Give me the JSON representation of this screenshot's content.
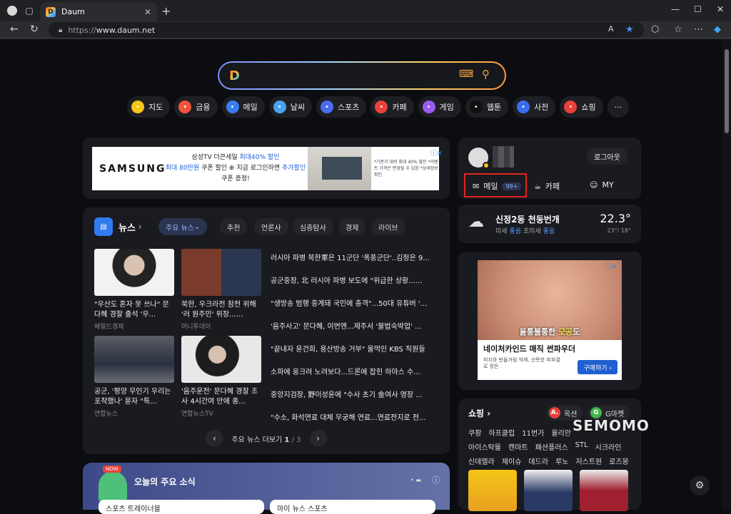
{
  "browser": {
    "tab_title": "Daum",
    "url_protocol": "https://",
    "url_host": "www.daum.net",
    "read_aloud_label": "A"
  },
  "search": {
    "placeholder": ""
  },
  "quick_links": [
    {
      "label": "지도",
      "icon": "map-pin-icon",
      "color": "#f5c518"
    },
    {
      "label": "금융",
      "icon": "chart-icon",
      "color": "#f2553c"
    },
    {
      "label": "메일",
      "icon": "mail-icon",
      "color": "#3a7df0"
    },
    {
      "label": "날씨",
      "icon": "cloud-icon",
      "color": "#4aa3f0"
    },
    {
      "label": "스포츠",
      "icon": "sports-icon",
      "color": "#4a6cf0"
    },
    {
      "label": "카페",
      "icon": "cafe-icon",
      "color": "#e8423a"
    },
    {
      "label": "게임",
      "icon": "game-icon",
      "color": "#9a5cf0"
    },
    {
      "label": "웹툰",
      "icon": "webtoon-icon",
      "color": "#111111"
    },
    {
      "label": "사전",
      "icon": "dictionary-icon",
      "color": "#3a6cf0"
    },
    {
      "label": "쇼핑",
      "icon": "shopping-icon",
      "color": "#e8423a"
    }
  ],
  "ad_samsung": {
    "brand": "SAMSUNG",
    "line1_a": "삼성TV 더큰세일 ",
    "line1_b": "최대40% 할인",
    "line2_a": "최대 80만원",
    "line2_b": " 쿠폰 할인 ",
    "line2_c": " 지금 로그인하면 ",
    "line2_d": "추가할인",
    "line2_e": " 쿠폰 증정!",
    "fine": "*기준가 대비 최대 40% 할인 *이벤트 가격은 변경될 수 있음 *상세정보 확인"
  },
  "news": {
    "title": "뉴스",
    "tabs": [
      "주요 뉴스",
      "추천",
      "언론사",
      "심층탐사",
      "경제",
      "라이브"
    ],
    "cards": [
      {
        "title": "\"우산도 혼자 못 쓰나\" 문다혜 경찰 출석 '우...",
        "source": "헤럴드경제"
      },
      {
        "title": "북한, 우크라전 참전 위해 '러 원주민' 위장......",
        "source": "머니투데이"
      },
      {
        "title": "공군, '평양 무인기 우리는 포착했나' 묻자 \"특...",
        "source": "연합뉴스"
      },
      {
        "title": "'음주운전' 문다혜 경찰 조사 4시간여 만에 종...",
        "source": "연합뉴스TV"
      }
    ],
    "headlines": [
      "러시아 파병 북한軍은 11군단 '폭풍군단'..김정은 9...",
      "공군중장, 北 러시아 파병 보도에 \"위급한 상황......",
      "\"생방송 범행 중계돼 국민에 충격\"...50대 유튜버 '...",
      "'음주사고' 문다혜, 이번엔...제주서 '불법숙박업' ...",
      "\"끝내자 윤건희, 용산방송 거부\" 울먹인 KBS 직원들",
      "소파에 웅크려 노려보다...드론에 잡힌 하마스 수...",
      "중앙지검장, 野이성윤에 \"수사 초기 金여사 영장 ...",
      "\"수소, 화석연료 대체 무궁해 연료...연료전지로 전..."
    ],
    "more_label": "주요 뉴스 더보기",
    "page_current": "1",
    "page_sep": "/",
    "page_total": "3"
  },
  "today": {
    "title": "오늘의 주요 소식",
    "badge": "NOW",
    "item1": "스포츠 트레이너블",
    "item2": "마이 뉴스 스포츠"
  },
  "login": {
    "logout_label": "로그아웃",
    "mail_label": "메일",
    "mail_badge": "99+",
    "cafe_label": "카페",
    "my_label": "MY"
  },
  "weather": {
    "location": "신정2동 천둥번개",
    "dust_label": "미세",
    "dust_value": "좋음",
    "fine_dust_label": "초미세",
    "fine_dust_value": "좋음",
    "temp": "22.3°",
    "range": "23°/ 18°"
  },
  "ad_nature": {
    "caption_a": "울퉁불퉁한 ",
    "caption_b": "모공",
    "caption_c": "도",
    "headline": "네이처카인드 매직 썬파우더",
    "pack": "피지와 번들거림 억제, 산뜻한 피부결로 정돈",
    "button": "구매하기 ›"
  },
  "shopping": {
    "title": "쇼핑",
    "chip1": "옥션",
    "chip2": "G마켓",
    "row1": [
      "쿠팡",
      "하프클럽",
      "11번가",
      "율리안"
    ],
    "row2": [
      "아이스탁몰",
      "캔마트",
      "패션플러스",
      "STL",
      "시크라인"
    ],
    "row3": [
      "신데렐라",
      "제이슈",
      "데드라",
      "루노",
      "저스트원",
      "로즈몽"
    ]
  },
  "watermark": "SEMOMO"
}
